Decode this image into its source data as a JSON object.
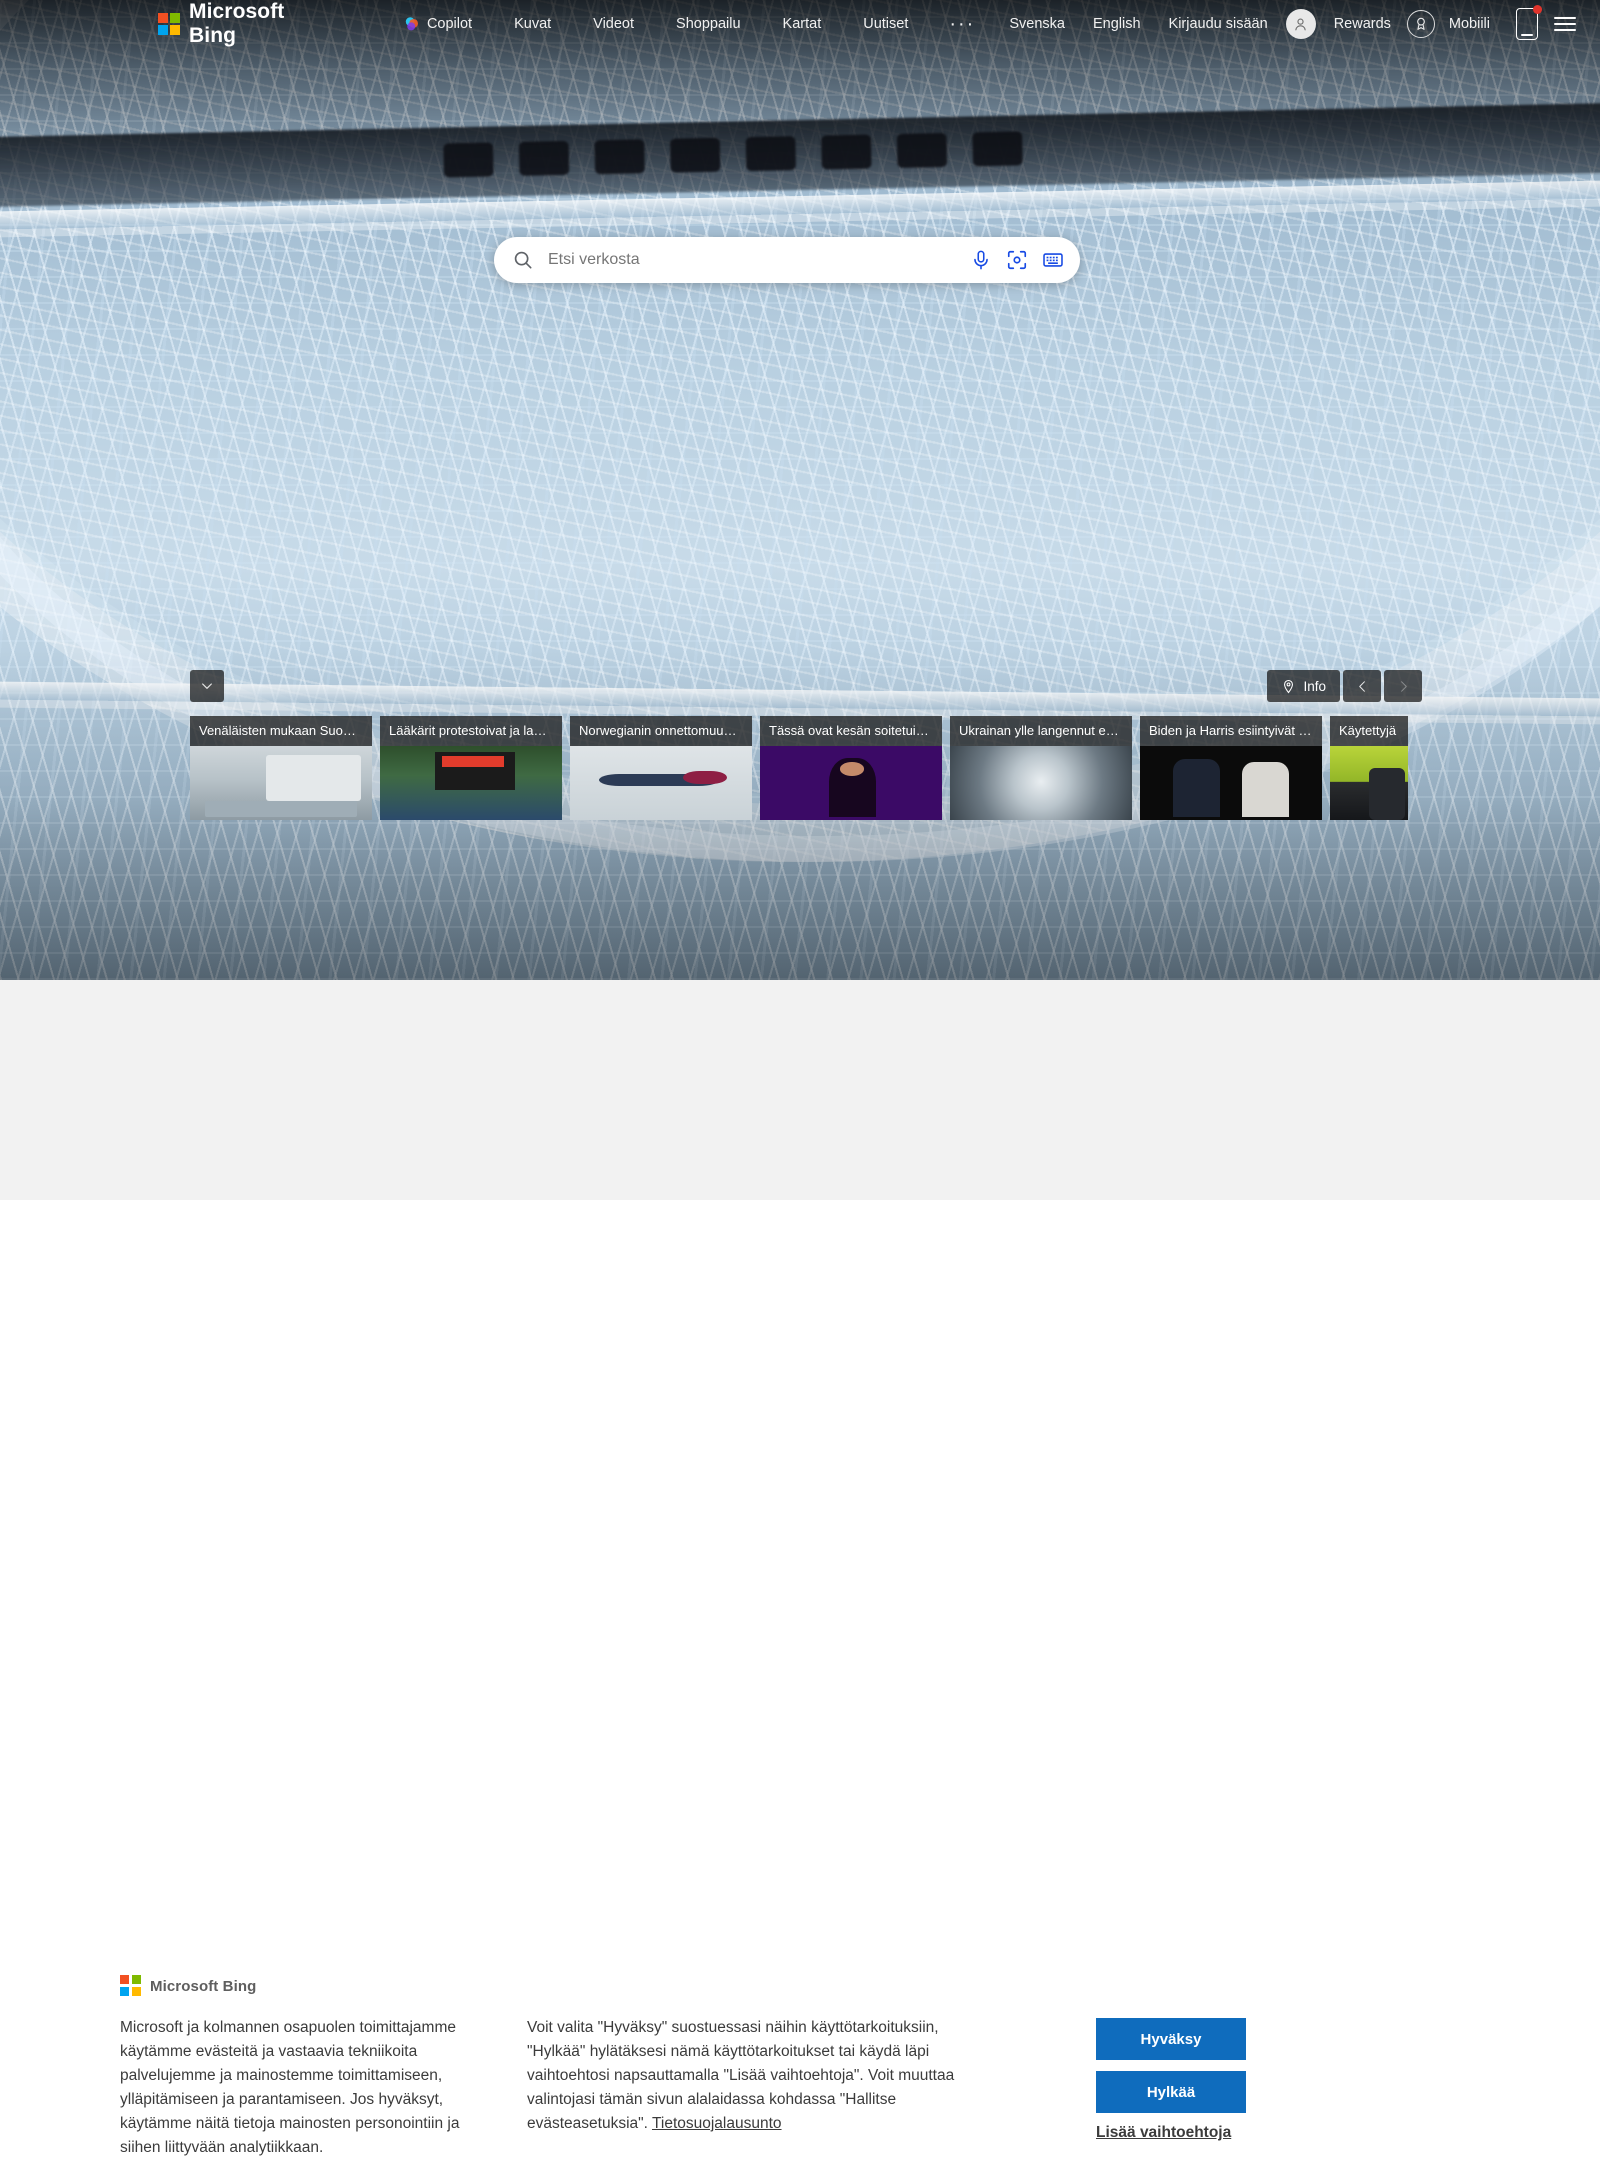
{
  "header": {
    "brand": "Microsoft Bing",
    "nav": [
      {
        "label": "Copilot",
        "icon": "copilot-icon"
      },
      {
        "label": "Kuvat",
        "icon": ""
      },
      {
        "label": "Videot",
        "icon": ""
      },
      {
        "label": "Shoppailu",
        "icon": ""
      },
      {
        "label": "Kartat",
        "icon": ""
      },
      {
        "label": "Uutiset",
        "icon": ""
      }
    ],
    "overflow_label": "···",
    "overflow_icon": "ellipsis-icon",
    "right": {
      "lang_sv": "Svenska",
      "lang_en": "English",
      "sign_in": "Kirjaudu sisään",
      "avatar_icon": "person-avatar-icon",
      "rewards": "Rewards",
      "rewards_icon": "rewards-medal-icon",
      "mobile": "Mobiili",
      "mobile_icon": "mobile-phone-icon",
      "menu_icon": "hamburger-menu-icon"
    }
  },
  "search": {
    "placeholder": "Etsi verkosta",
    "value": "",
    "search_icon": "search-icon",
    "mic_icon": "microphone-icon",
    "camera_icon": "visual-search-camera-icon",
    "keyboard_icon": "keyboard-icon",
    "accent_color": "#174ae4"
  },
  "hero": {
    "collapse_icon": "chevron-down-icon",
    "info_label": "Info",
    "info_icon": "location-pin-icon",
    "prev_icon": "chevron-left-icon",
    "next_icon": "chevron-right-icon",
    "next_disabled": true
  },
  "news": {
    "cards": [
      {
        "title": "Venäläisten mukaan Suo…",
        "art": "t-ship"
      },
      {
        "title": "Lääkärit protestoivat ja lak…",
        "art": "t-protest"
      },
      {
        "title": "Norwegianin onnettomuus…",
        "art": "t-plane"
      },
      {
        "title": "Tässä ovat kesän soitetui…",
        "art": "t-singer"
      },
      {
        "title": "Ukrainan ylle langennut e…",
        "art": "t-crater"
      },
      {
        "title": "Biden ja Harris esiintyivät …",
        "art": "t-rally"
      },
      {
        "title": "Käytettyjä",
        "art": "t-car"
      }
    ]
  },
  "consent": {
    "brand": "Microsoft Bing",
    "paragraph1": "Microsoft ja kolmannen osapuolen toimittajamme käytämme evästeitä ja vastaavia tekniikoita palvelujemme ja mainostemme toimittamiseen, ylläpitämiseen ja parantamiseen. Jos hyväksyt, käytämme näitä tietoja mainosten personointiin ja siihen liittyvään analytiikkaan.",
    "paragraph2": "Voit valita \"Hyväksy\" suostuessasi näihin käyttötarkoituksiin, \"Hylkää\" hylätäksesi nämä käyttötarkoitukset tai käydä läpi vaihtoehtosi napsauttamalla \"Lisää vaihtoehtoja\". Voit muuttaa valintojasi tämän sivun alalaidassa kohdassa \"Hallitse evästeasetuksia\". ",
    "privacy_link": "Tietosuojalausunto",
    "accept_label": "Hyväksy",
    "reject_label": "Hylkää",
    "more_label": "Lisää vaihtoehtoja",
    "button_color": "#0f6cbd"
  }
}
